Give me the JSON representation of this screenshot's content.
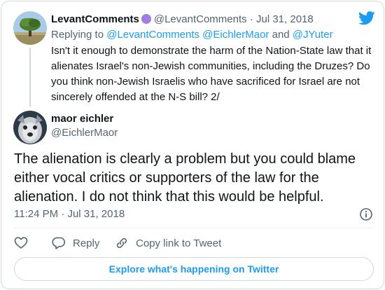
{
  "colors": {
    "accent": "#1d9bf0",
    "text": "#0f1419",
    "muted": "#536471",
    "border": "#cfd9de",
    "badge": "#9f7ee0"
  },
  "quoted_tweet": {
    "display_name": "LevantComments",
    "handle": "@LevantComments",
    "separator": "·",
    "date": "Jul 31, 2018",
    "reply_prefix": "Replying to",
    "reply_to": [
      "@LevantComments",
      "@EichlerMaor"
    ],
    "reply_and": "and",
    "reply_to_last": "@JYuter",
    "text": "Isn't it enough to demonstrate the harm of the Nation-State law that it alienates Israel's non-Jewish communities, including the Druzes? Do you think non-Jewish Israelis who have sacrificed for Israel are not sincerely offended at the N-S bill? 2/",
    "avatar_icon": "tree-landscape-avatar",
    "verified_icon": "purple-circle-badge-icon"
  },
  "main_tweet": {
    "display_name": "maor eichler",
    "handle": "@EichlerMaor",
    "text": "The alienation is clearly a problem but you could blame either vocal critics or supporters of the law for the alienation. I do not think that this would be helpful.",
    "time": "11:24 PM",
    "separator": "·",
    "date": "Jul 31, 2018",
    "avatar_icon": "dog-photo-avatar"
  },
  "actions": {
    "like_icon": "heart-icon",
    "reply_label": "Reply",
    "reply_icon": "reply-bubble-icon",
    "copy_label": "Copy link to Tweet",
    "copy_icon": "link-icon"
  },
  "explore_button": {
    "label": "Explore what's happening on Twitter"
  },
  "brand_icon": "twitter-bird-icon",
  "info_icon": "info-icon"
}
